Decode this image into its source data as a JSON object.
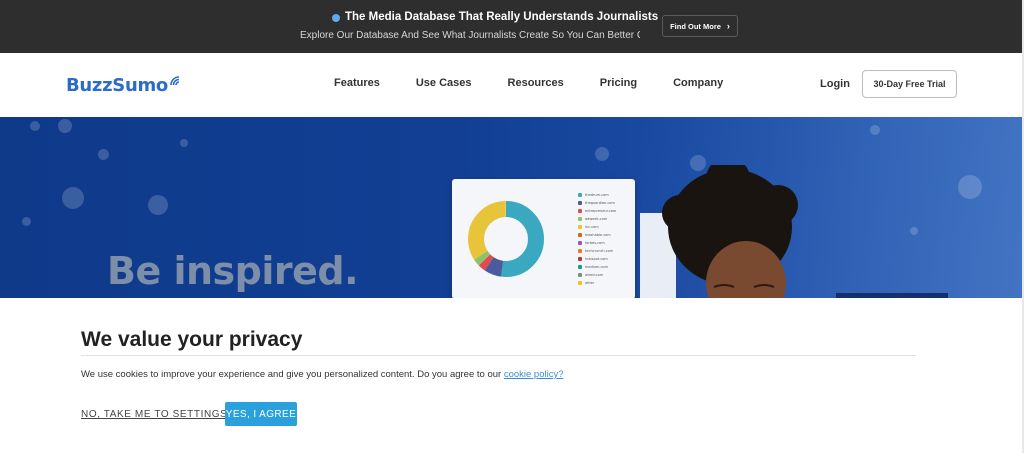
{
  "promo": {
    "title": "The Media Database That Really Understands Journalists",
    "subtitle": "Explore Our Database And See What Journalists Create So You Can Better Connect With Them",
    "button_label": "Find Out More",
    "dot_color": "#5fa9ef"
  },
  "nav": {
    "logo": "BuzzSumo",
    "links": [
      "Features",
      "Use Cases",
      "Resources",
      "Pricing",
      "Company"
    ],
    "login": "Login",
    "trial_button": "30-Day Free Trial",
    "brand_color": "#2b6cc8"
  },
  "hero": {
    "title": "Be inspired.",
    "card_legend": [
      "thedrum.com",
      "theguardian.com",
      "entrepreneur.com",
      "adweek.com",
      "inc.com",
      "mashable.com",
      "forbes.com",
      "techcrunch.com",
      "hubspot.com",
      "medium.com",
      "wired.com",
      "other"
    ]
  },
  "privacy": {
    "title": "We value your privacy",
    "text": "We use cookies to improve your experience and give you personalized content. Do you agree to our",
    "policy_link": "cookie policy?",
    "settings_label": "NO, TAKE ME TO SETTINGS",
    "agree_label": "YES, I AGREE",
    "accent_color": "#2aa0dd"
  }
}
